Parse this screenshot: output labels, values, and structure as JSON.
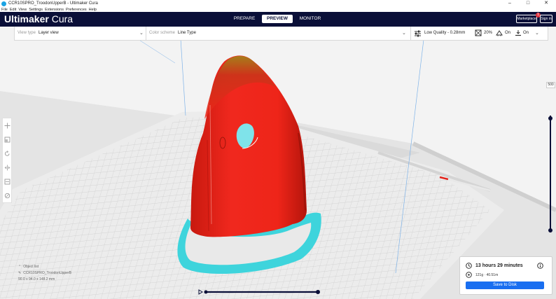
{
  "window": {
    "title": "CCR10SPRO_TroodonUpperB - Ultimaker Cura",
    "minimize": "–",
    "maximize": "□",
    "close": "✕"
  },
  "menu": [
    "File",
    "Edit",
    "View",
    "Settings",
    "Extensions",
    "Preferences",
    "Help"
  ],
  "header": {
    "logo_bold": "Ultimaker",
    "logo_light": " Cura",
    "tabs": [
      {
        "label": "PREPARE"
      },
      {
        "label": "PREVIEW"
      },
      {
        "label": "MONITOR"
      }
    ],
    "marketplace": "Marketplace",
    "marketplace_badge": "1",
    "signin": "Sign in"
  },
  "toolbar": {
    "view_type_label": "View type",
    "view_type_value": "Layer view",
    "color_scheme_label": "Color scheme",
    "color_scheme_value": "Line Type",
    "quality": "Low Quality - 0.28mm",
    "infill": "20%",
    "support": "On",
    "adhesion": "On"
  },
  "object": {
    "list_label": "Object list",
    "name": "CCR10SPRO_TroodonUpperB",
    "dimensions": "90.0 x 94.0 x 148.2 mm"
  },
  "layer": {
    "current": "500"
  },
  "print": {
    "time": "13 hours 29 minutes",
    "material": "121g · 40.51m",
    "save": "Save to Disk"
  },
  "colors": {
    "header_bg": "#0a0f38",
    "accent": "#196ef0",
    "model_wall": "#e8221a",
    "skirt": "#3ed4dc",
    "badge": "#e3323d"
  }
}
